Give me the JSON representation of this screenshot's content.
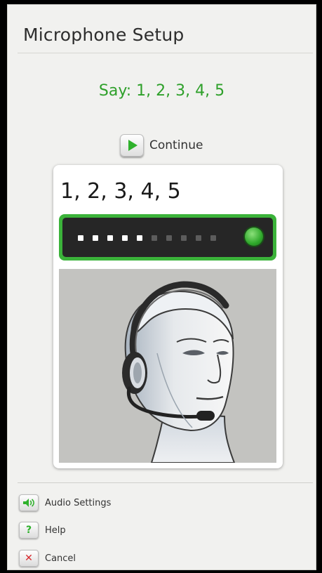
{
  "window": {
    "title": "Microphone Setup"
  },
  "prompt": {
    "text": "Say: 1, 2, 3, 4, 5"
  },
  "continue_button": {
    "label": "Continue",
    "icon": "play-icon"
  },
  "card": {
    "digits": "1, 2, 3, 4, 5",
    "level_meter": {
      "lit_segments": 5,
      "total_segments": 10,
      "indicator": "green-status-icon"
    },
    "figure": "headset-figure"
  },
  "footer": {
    "items": [
      {
        "label": "Audio Settings",
        "icon": "speaker-icon"
      },
      {
        "label": "Help",
        "icon": "question-icon"
      },
      {
        "label": "Cancel",
        "icon": "close-icon"
      }
    ]
  },
  "colors": {
    "accent_green": "#2ea02a",
    "cancel_red": "#d8282c"
  }
}
